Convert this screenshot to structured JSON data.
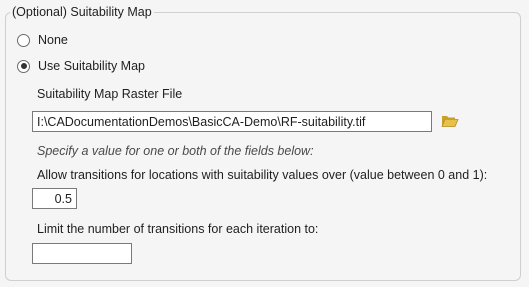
{
  "group": {
    "title": "(Optional) Suitability Map"
  },
  "options": {
    "none_label": "None",
    "use_map_label": "Use Suitability Map",
    "selected": "use_map"
  },
  "raster": {
    "label": "Suitability Map Raster File",
    "path": "I:\\CADocumentationDemos\\BasicCA-Demo\\RF-suitability.tif",
    "browse_icon": "folder-open-icon"
  },
  "hint": "Specify a value for one or both of the fields below:",
  "threshold": {
    "label": "Allow transitions for locations with suitability values over (value between 0 and 1):",
    "value": "0.5"
  },
  "limit": {
    "label": "Limit the number of transitions for each iteration to:",
    "value": ""
  },
  "colors": {
    "background": "#f5f5f5",
    "folder": "#d9b43c"
  }
}
